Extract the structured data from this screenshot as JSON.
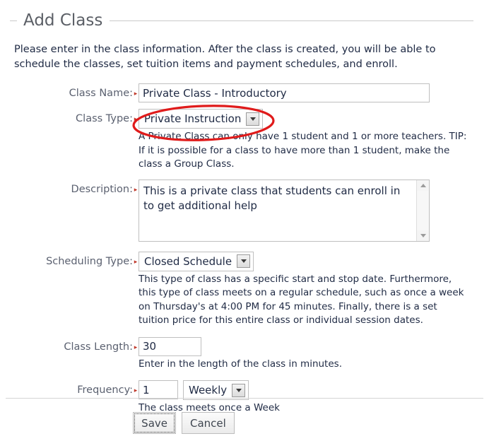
{
  "panel": {
    "title": "Add Class"
  },
  "intro": "Please enter in the class information. After the class is created, you will be able to schedule the classes, set tuition items and payment schedules, and enroll.",
  "required_marker": "▸",
  "form": {
    "class_name": {
      "label": "Class Name:",
      "value": "Private Class - Introductory",
      "placeholder": ""
    },
    "class_type": {
      "label": "Class Type:",
      "value": "Private Instruction",
      "help": "A Private Class can only have 1 student and 1 or more teachers. TIP: If it is possible for a class to have more than 1 student, make the class a Group Class."
    },
    "description": {
      "label": "Description:",
      "value": "This is a private class that students can enroll in to get additional help",
      "placeholder": ""
    },
    "scheduling_type": {
      "label": "Scheduling Type:",
      "value": "Closed Schedule",
      "help": "This type of class has a specific start and stop date. Furthermore, this type of class meets on a regular schedule, such as once a week on Thursday's at 4:00 PM for 45 minutes. Finally, there is a set tuition price for this entire class or individual session dates."
    },
    "class_length": {
      "label": "Class Length:",
      "value": "30",
      "help": "Enter in the length of the class in minutes."
    },
    "frequency": {
      "label": "Frequency:",
      "value": "1",
      "unit_value": "Weekly",
      "help": "The class meets once a Week"
    }
  },
  "footer": {
    "save_label": "Save",
    "cancel_label": "Cancel"
  },
  "annotation": {
    "shape": "ellipse",
    "color": "#e01b1b",
    "target": "class-type-select"
  },
  "colors": {
    "label_text": "#5b6170",
    "body_text": "#1f2a44",
    "title_text": "#5b5f66",
    "required_marker": "#c0392b",
    "border": "#bfbfbf",
    "rule": "#c9c9c9",
    "annotation_red": "#e01b1b"
  }
}
